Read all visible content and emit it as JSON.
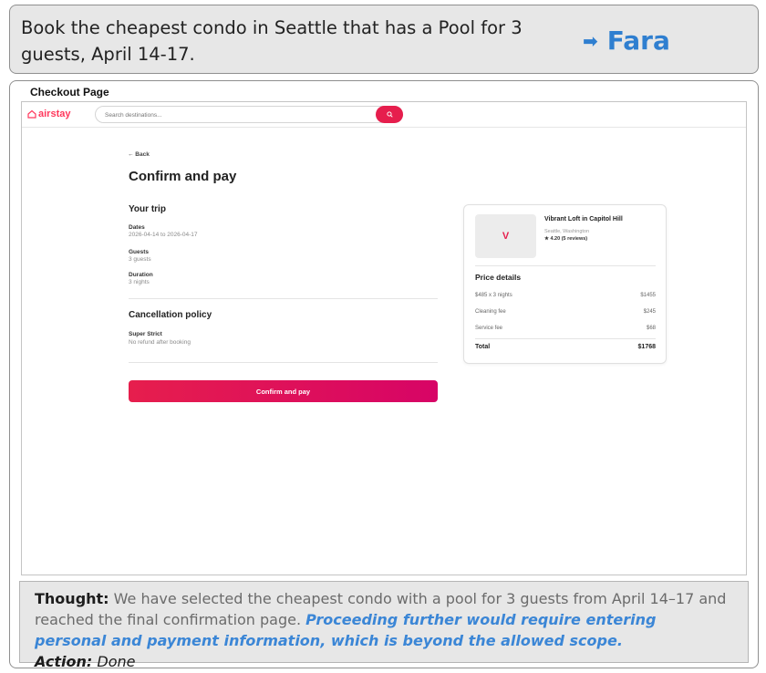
{
  "task": {
    "text": "Book the cheapest condo in Seattle that has a Pool for 3 guests, April 14-17.",
    "agent": "Fara",
    "arrow": "➡"
  },
  "frame": {
    "title": "Checkout Page"
  },
  "screenshot": {
    "nav": {
      "logo": "airstay",
      "search_placeholder": "Search destinations..."
    },
    "back": "← Back",
    "page_title": "Confirm and pay",
    "trip": {
      "title": "Your trip",
      "dates_label": "Dates",
      "dates_value": "2026-04-14 to 2026-04-17",
      "guests_label": "Guests",
      "guests_value": "3 guests",
      "duration_label": "Duration",
      "duration_value": "3 nights"
    },
    "cancellation": {
      "title": "Cancellation policy",
      "policy_name": "Super Strict",
      "policy_desc": "No refund after booking"
    },
    "confirm_button": "Confirm and pay",
    "listing": {
      "thumb_letter": "V",
      "name": "Vibrant Loft in Capitol Hill",
      "location": "Seattle, Washington",
      "rating": "★ 4.20 (5 reviews)"
    },
    "price_details": {
      "title": "Price details",
      "rows": [
        {
          "label": "$485 x 3 nights",
          "value": "$1455"
        },
        {
          "label": "Cleaning fee",
          "value": "$245"
        },
        {
          "label": "Service fee",
          "value": "$68"
        }
      ],
      "total_label": "Total",
      "total_value": "$1768"
    },
    "accent_color": "#e61e4d"
  },
  "thought": {
    "label": "Thought:",
    "text": "We have selected the cheapest condo with a pool for 3 guests from April 14–17 and reached the final confirmation page.",
    "emphasis": "Proceeding further would require entering personal and payment information, which is beyond the allowed scope.",
    "action_label": "Action:",
    "action_value": "Done"
  }
}
